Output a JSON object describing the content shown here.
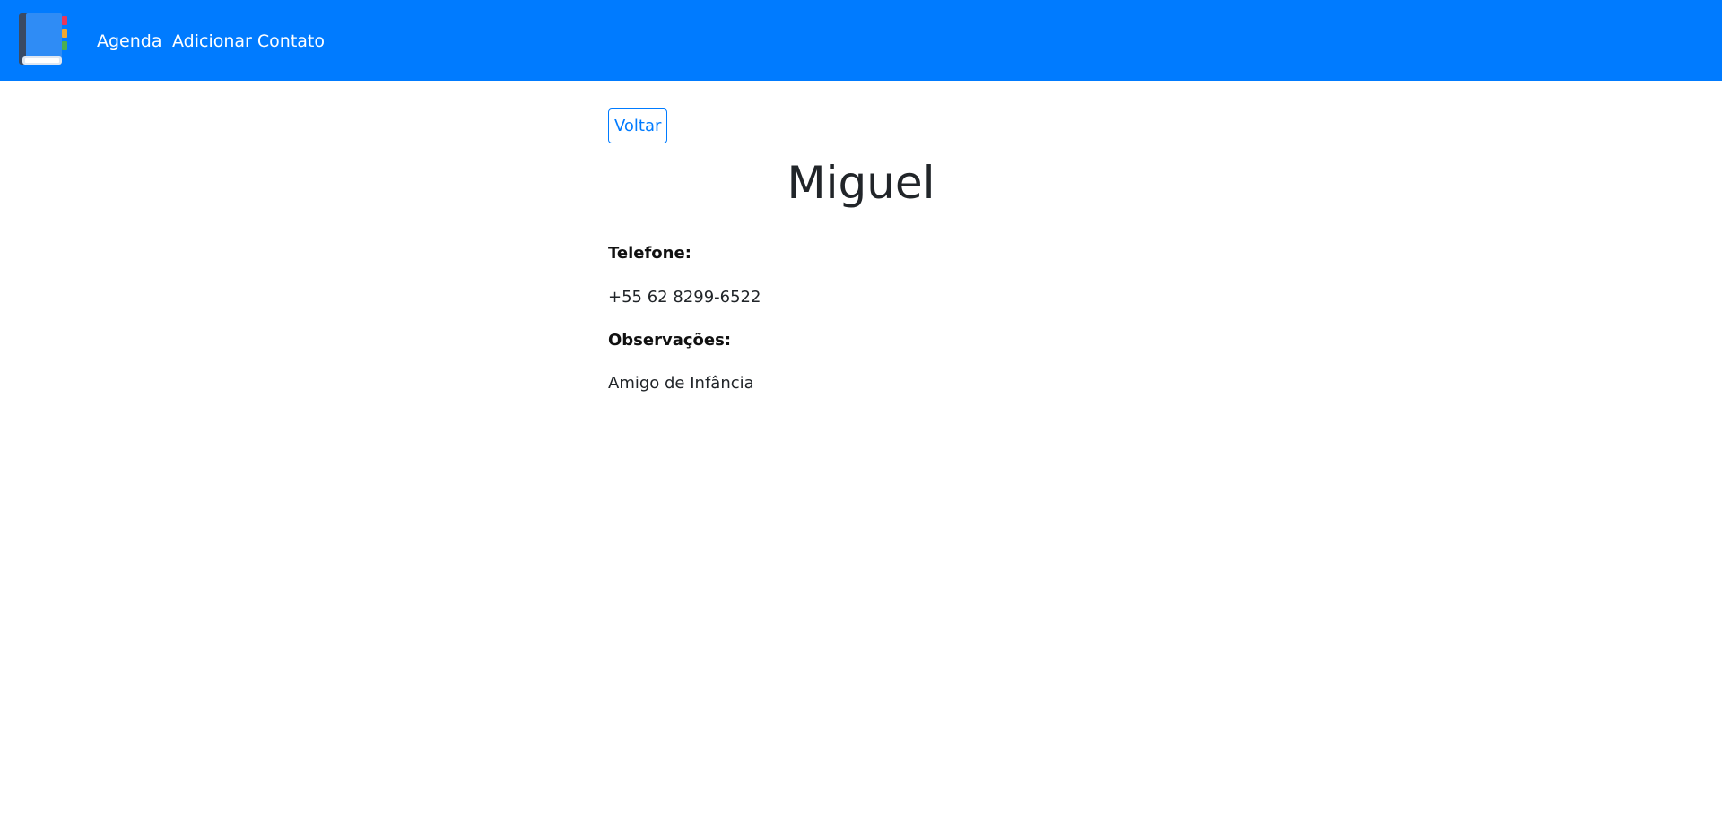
{
  "navbar": {
    "background_color": "#007bff",
    "brand_icon": "address-book-icon",
    "links": [
      {
        "label": "Agenda"
      },
      {
        "label": "Adicionar Contato"
      }
    ]
  },
  "contact": {
    "back_button_label": "Voltar",
    "name": "Miguel",
    "phone_label": "Telefone:",
    "phone_value": "+55 62 8299-6522",
    "notes_label": "Observações:",
    "notes_value": "Amigo de Infância"
  },
  "colors": {
    "accent": "#007bff",
    "text": "#212529"
  }
}
